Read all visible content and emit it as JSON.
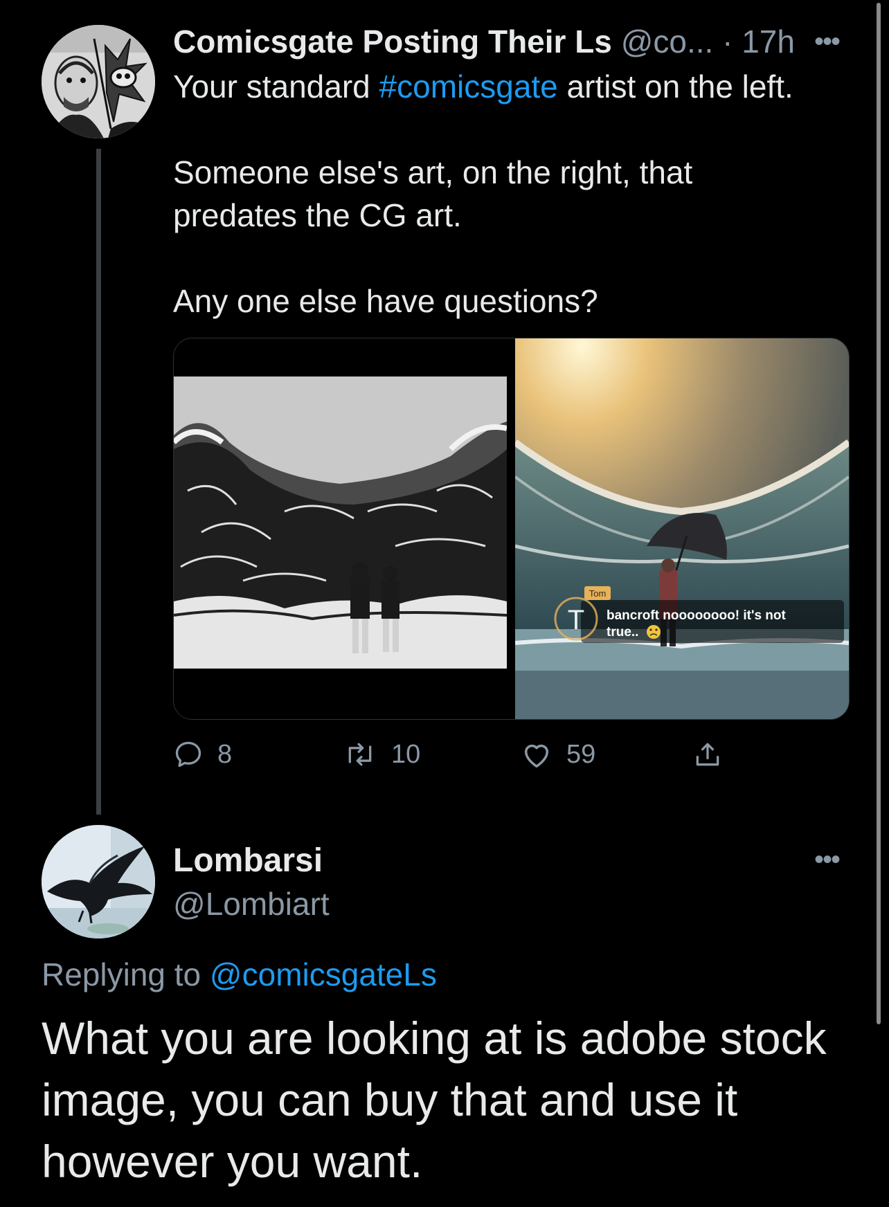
{
  "tweet1": {
    "author_name": "Comicsgate Posting Their Ls",
    "handle": "@co...",
    "separator": "·",
    "time": "17h",
    "text": {
      "line1_before": "Your standard ",
      "hashtag": "#comicsgate",
      "line1_after": " artist on the left.",
      "para2": "Someone else's art, on the right, that predates the CG art.",
      "para3": "Any one else have questions?"
    },
    "media_overlay": {
      "name_tag": "Tom",
      "initial": "T",
      "caption_line1": "bancroft noooooooo! it's not",
      "caption_line2": "true.. "
    },
    "actions": {
      "replies": "8",
      "retweets": "10",
      "likes": "59"
    }
  },
  "tweet2": {
    "author_name": "Lombarsi",
    "handle": "@Lombiart",
    "replying_prefix": "Replying to ",
    "replying_to": "@comicsgateLs",
    "text": "What you are looking at is adobe stock image, you can buy that and use it however you want."
  },
  "icons": {
    "more": "more-horizontal-icon",
    "reply": "reply-bubble-icon",
    "retweet": "retweet-icon",
    "like": "heart-icon",
    "share": "share-icon"
  },
  "colors": {
    "background": "#000000",
    "text_primary": "#e7e9ea",
    "text_secondary": "#8b98a5",
    "link": "#1d9bf0",
    "thread_line": "#3c3f42"
  }
}
